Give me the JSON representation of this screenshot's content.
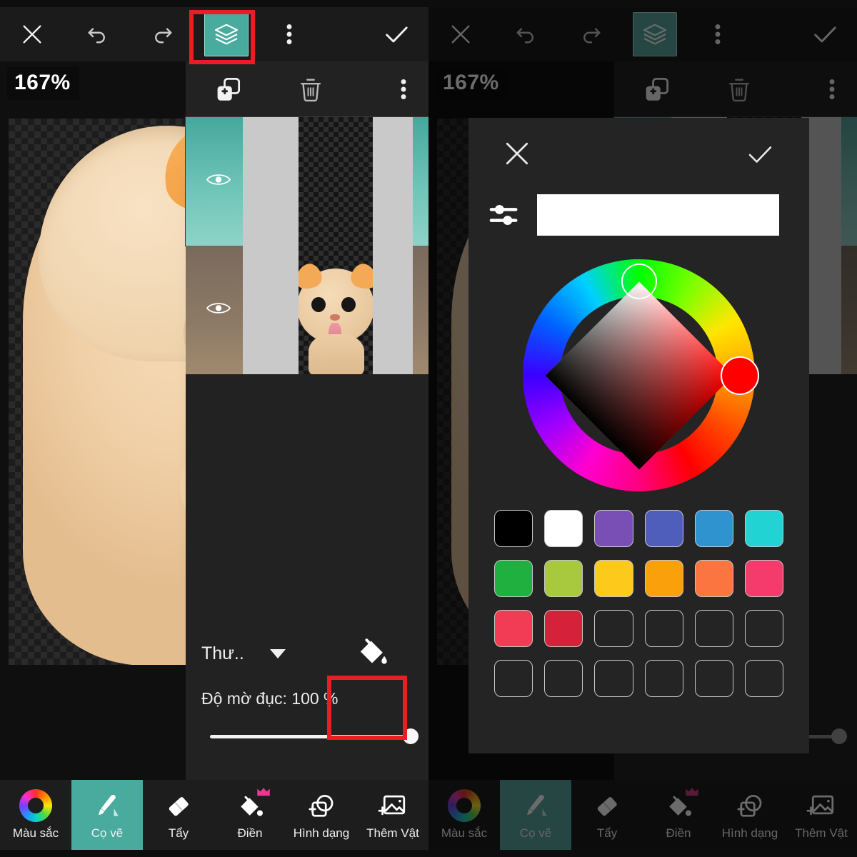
{
  "app": {
    "zoom_label": "167%",
    "accent_teal": "#49aa9e",
    "annotation_color": "#ec1c24",
    "panel_bg": "#222222",
    "dialog_bg": "#242424"
  },
  "topbar": {
    "close_label": "close-icon",
    "undo_label": "undo-icon",
    "redo_label": "redo-icon",
    "layers_label": "layers-icon",
    "more_label": "more-options-icon",
    "confirm_label": "confirm-icon"
  },
  "layers_panel": {
    "tools": {
      "add_layer": "add-layer-icon",
      "delete_layer": "delete-layer-icon",
      "more": "layer-more-icon"
    },
    "layers": [
      {
        "name": "layer-1",
        "visible": true,
        "selected": true,
        "thumb_kind": "teal-empty"
      },
      {
        "name": "layer-2",
        "visible": true,
        "selected": false,
        "thumb_kind": "cat-photo"
      }
    ],
    "blend_mode": "Thư..",
    "opacity_label": "Độ mờ đục: 100 %",
    "opacity_value": 100,
    "fill_tool": "paint-bucket-icon"
  },
  "bottom_toolbar": {
    "items": [
      {
        "label": "Màu sắc",
        "icon": "color-wheel-icon",
        "active": false,
        "premium": false
      },
      {
        "label": "Cọ vẽ",
        "icon": "brush-icon",
        "active": true,
        "premium": false
      },
      {
        "label": "Tẩy",
        "icon": "eraser-icon",
        "active": false,
        "premium": false
      },
      {
        "label": "Điền",
        "icon": "fill-icon",
        "active": false,
        "premium": true
      },
      {
        "label": "Hình dạng",
        "icon": "shape-icon",
        "active": false,
        "premium": false
      },
      {
        "label": "Thêm Vật",
        "icon": "add-image-icon",
        "active": false,
        "premium": false
      }
    ]
  },
  "color_picker": {
    "close_label": "close-icon",
    "confirm_label": "confirm-icon",
    "sliders_label": "sliders-icon",
    "preview_color": "#ffffff",
    "hue_selected": "#ff0000",
    "wheel_label": "color-wheel",
    "swatches": [
      {
        "color": "#000000",
        "empty": false
      },
      {
        "color": "#ffffff",
        "empty": false
      },
      {
        "color": "#7a4fb5",
        "empty": false
      },
      {
        "color": "#4f5dbb",
        "empty": false
      },
      {
        "color": "#2f93cf",
        "empty": false
      },
      {
        "color": "#22d3d3",
        "empty": false
      },
      {
        "color": "#1fb03f",
        "empty": false
      },
      {
        "color": "#a8c83e",
        "empty": false
      },
      {
        "color": "#fdc91b",
        "empty": false
      },
      {
        "color": "#f9a00b",
        "empty": false
      },
      {
        "color": "#fb7540",
        "empty": false
      },
      {
        "color": "#f43b6b",
        "empty": false
      },
      {
        "color": "#f23b55",
        "empty": false
      },
      {
        "color": "#d6213a",
        "empty": false
      },
      {
        "color": "",
        "empty": true
      },
      {
        "color": "",
        "empty": true
      },
      {
        "color": "",
        "empty": true
      },
      {
        "color": "",
        "empty": true
      },
      {
        "color": "",
        "empty": true
      },
      {
        "color": "",
        "empty": true
      },
      {
        "color": "",
        "empty": true
      },
      {
        "color": "",
        "empty": true
      },
      {
        "color": "",
        "empty": true
      },
      {
        "color": "",
        "empty": true
      }
    ]
  }
}
